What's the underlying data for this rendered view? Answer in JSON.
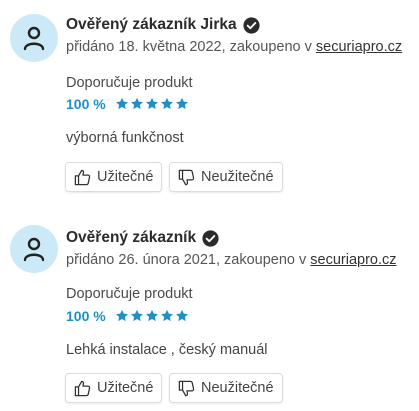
{
  "reviews": [
    {
      "author": "Ověřený zákazník Jirka",
      "meta_prefix": "přidáno 18. května 2022, zakoupeno v ",
      "shop": "securiapro.cz",
      "recommend_label": "Doporučuje produkt",
      "percent": "100 %",
      "stars": 5,
      "comment": "výborná funkčnost",
      "helpful_label": "Užitečné",
      "unhelpful_label": "Neužitečné"
    },
    {
      "author": "Ověřený zákazník",
      "meta_prefix": "přidáno 26. února 2021, zakoupeno v ",
      "shop": "securiapro.cz",
      "recommend_label": "Doporučuje produkt",
      "percent": "100 %",
      "stars": 5,
      "comment": "Lehká instalace , český manuál",
      "helpful_label": "Užitečné",
      "unhelpful_label": "Neužitečné"
    }
  ],
  "colors": {
    "accent": "#1e8fc7",
    "avatar_bg": "#cce9f7",
    "star": "#1e8fc7"
  },
  "icons": {
    "avatar": "user-icon",
    "verified": "check-circle-icon",
    "star": "star-icon",
    "helpful": "thumbs-up-icon",
    "unhelpful": "thumbs-down-icon"
  }
}
